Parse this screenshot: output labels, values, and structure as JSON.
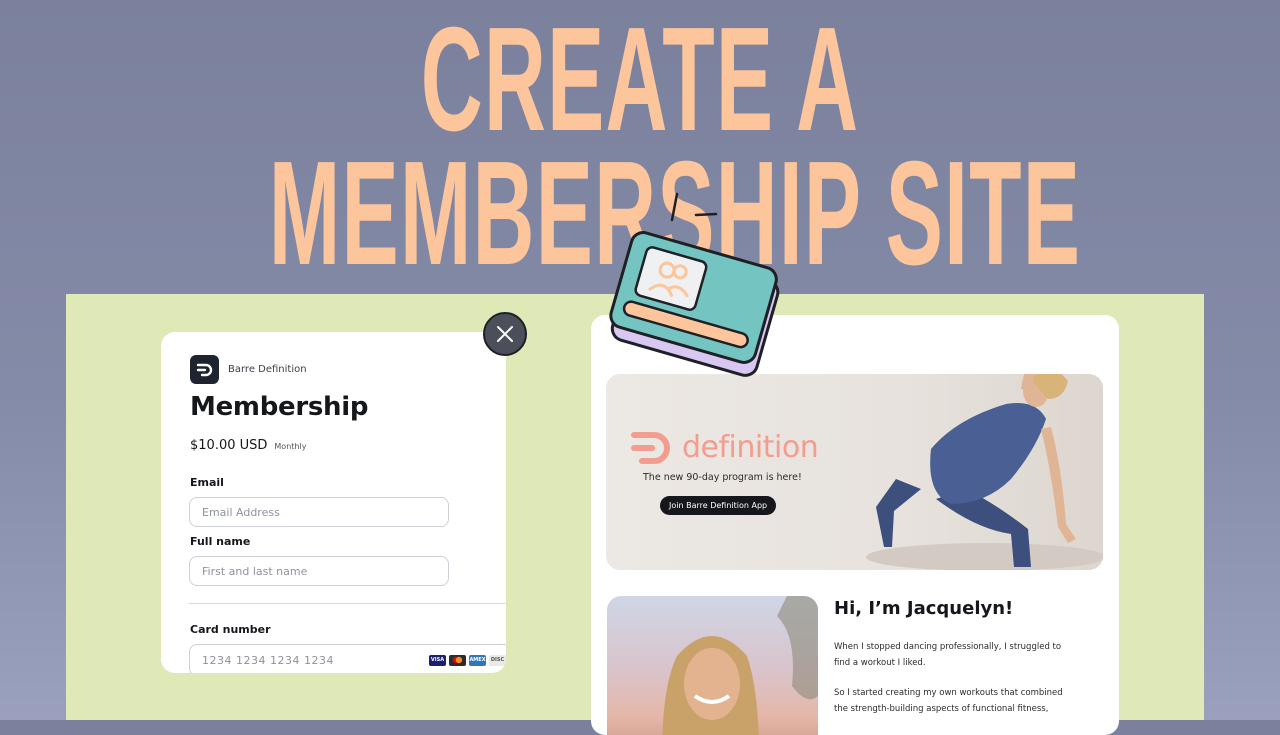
{
  "headline": {
    "line1": "CREATE A",
    "line2": "MEMBERSHIP SITE"
  },
  "checkout": {
    "brand_name": "Barre Definition",
    "title": "Membership",
    "price": "$10.00 USD",
    "period": "Monthly",
    "email_label": "Email",
    "email_placeholder": "Email Address",
    "name_label": "Full name",
    "name_placeholder": "First and last name",
    "card_label": "Card number",
    "card_placeholder": "1234  1234  1234  1234",
    "card_brands": [
      "VISA",
      "MC",
      "AMEX",
      "DISC"
    ]
  },
  "site": {
    "hero_wordmark": "definition",
    "hero_tagline": "The new 90-day program is here!",
    "hero_cta": "Join Barre Definition App",
    "about_title": "Hi, I’m Jacquelyn!",
    "about_p1_l1": "When I stopped dancing professionally, I struggled to",
    "about_p1_l2": "find a workout I liked.",
    "about_p2_l1": "So I started creating my own workouts that combined",
    "about_p2_l2": "the strength-building aspects of functional fitness,"
  },
  "colors": {
    "headline": "#fcc59b",
    "panel": "#dfe9b7",
    "accent": "#f29d8f"
  }
}
